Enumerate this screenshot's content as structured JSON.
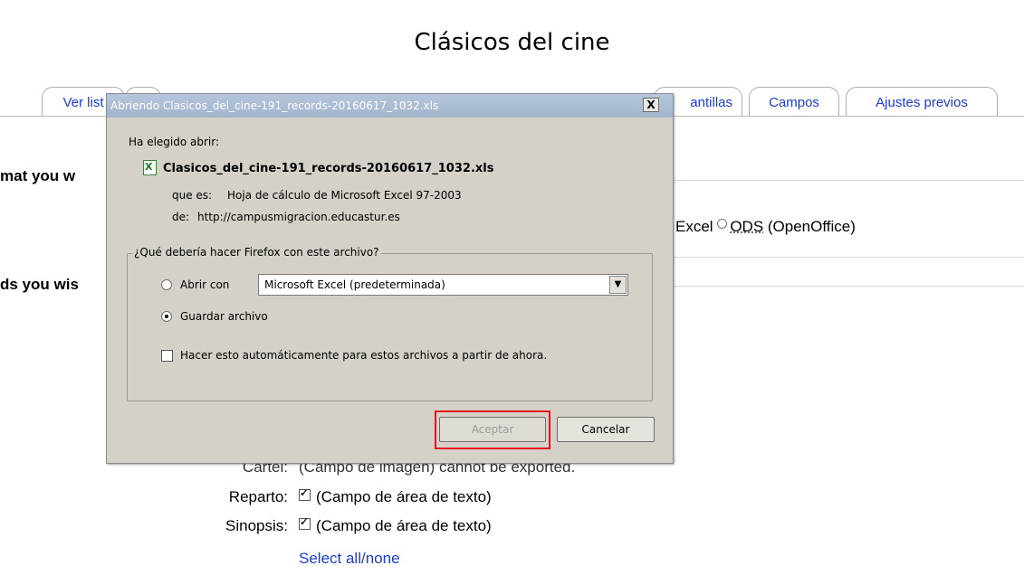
{
  "page": {
    "title": "Clásicos del cine",
    "tabs": [
      "Ver list",
      "antillas",
      "Campos",
      "Ajustes previos"
    ],
    "format_heading": "mat you w",
    "format_options_text": "Excel",
    "format_option_ods": "ODS",
    "format_option_ods_suffix": "(OpenOffice)",
    "fields_heading": "ds you wis",
    "fields": [
      {
        "label": "Cartel:",
        "value": "(Campo de imagen) cannot be exported."
      },
      {
        "label": "Reparto:",
        "value": "(Campo de área de texto)"
      },
      {
        "label": "Sinopsis:",
        "value": "(Campo de área de texto)"
      }
    ],
    "select_all": "Select all/none"
  },
  "dialog": {
    "title": "Abriendo Clasicos_del_cine-191_records-20160617_1032.xls",
    "close_label": "X",
    "intro": "Ha elegido abrir:",
    "filename": "Clasicos_del_cine-191_records-20160617_1032.xls",
    "type_label": "que es:",
    "type_value": "Hoja de cálculo de Microsoft Excel 97-2003",
    "from_label": "de:",
    "from_value": "http://campusmigracion.educastur.es",
    "question": "¿Qué debería hacer Firefox con este archivo?",
    "open_with_label": "Abrir con",
    "open_with_value": "Microsoft Excel (predeterminada)",
    "save_label": "Guardar archivo",
    "auto_label": "Hacer esto automáticamente para estos archivos a partir de ahora.",
    "accept_label": "Aceptar",
    "cancel_label": "Cancelar",
    "selected_option": "Guardar archivo"
  }
}
